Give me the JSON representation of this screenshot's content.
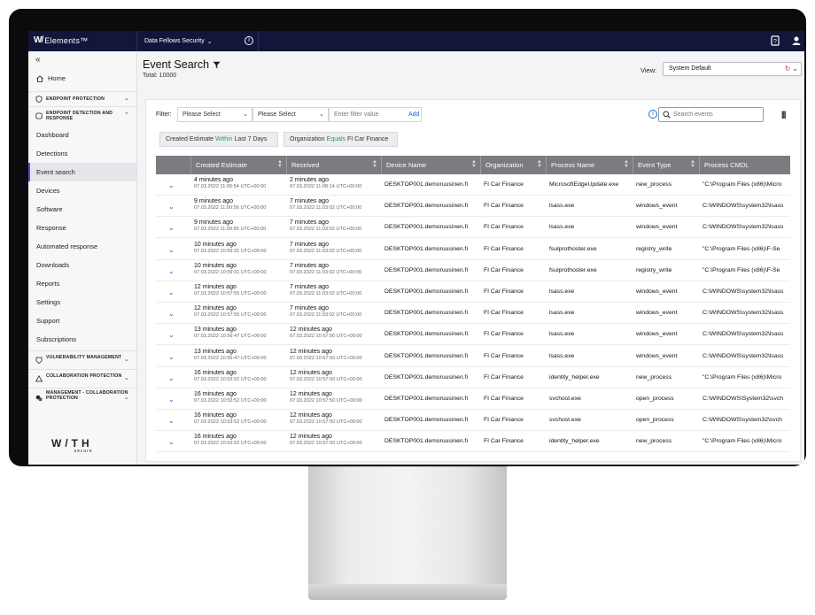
{
  "topbar": {
    "brand": "Elements™",
    "brand_mark": "W/",
    "org": "Data Fellows Security",
    "org_chevron": "⌄"
  },
  "sidebar": {
    "collapse": "«",
    "home": "Home",
    "groups": [
      {
        "label": "ENDPOINT PROTECTION",
        "icon": "shield-icon",
        "chevron": "⌄"
      },
      {
        "label": "ENDPOINT DETECTION AND RESPONSE",
        "icon": "edr-icon",
        "chevron": "⌃"
      }
    ],
    "items": [
      "Dashboard",
      "Detections",
      "Event search",
      "Devices",
      "Software",
      "Response",
      "Automated response",
      "Downloads",
      "Reports",
      "Settings",
      "Support",
      "Subscriptions"
    ],
    "active_item": "Event search",
    "groups_bottom": [
      {
        "label": "VULNERABILITY MANAGEMENT",
        "icon": "vulnerability-icon",
        "chevron": "⌄"
      },
      {
        "label": "COLLABORATION PROTECTION",
        "icon": "collaboration-icon",
        "chevron": "⌄"
      },
      {
        "label": "MANAGEMENT - COLLABORATION PROTECTION",
        "icon": "management-icon",
        "chevron": "⌄"
      }
    ],
    "logo": "W/TH",
    "logo_sub": "secure"
  },
  "page": {
    "title": "Event Search",
    "total": "Total: 10000",
    "view_label": "View:",
    "view_value": "System Default"
  },
  "filters": {
    "label": "Filter:",
    "select1": "Please Select",
    "select2": "Please Select",
    "value_placeholder": "Enter filter value",
    "add": "Add",
    "search_placeholder": "Search events",
    "chips": [
      {
        "field": "Created Estimate",
        "op": "Within",
        "value": "Last 7 Days"
      },
      {
        "field": "Organization",
        "op": "Equals",
        "value": "FI Car Finance"
      }
    ]
  },
  "table": {
    "columns": [
      "Created Estimate",
      "Received",
      "Device Name",
      "Organization",
      "Process Name",
      "Event Type",
      "Process CMDL"
    ],
    "rows": [
      {
        "created": "4 minutes ago",
        "created_ts": "07.03.2022 11:05:54 UTC+00:00",
        "received": "2 minutes ago",
        "received_ts": "07.03.2022 11:08:14 UTC+00:00",
        "device": "DESKTOP001.demoruusinen.fi",
        "org": "FI Car Finance",
        "process": "MicrosoftEdgeUpdate.exe",
        "event": "new_process",
        "cmdl": "\"C:\\Program Files (x86)\\Micro"
      },
      {
        "created": "9 minutes ago",
        "created_ts": "07.03.2022 11:00:56 UTC+00:00",
        "received": "7 minutes ago",
        "received_ts": "07.03.2022 11:03:02 UTC+00:00",
        "device": "DESKTOP001.demoruusinen.fi",
        "org": "FI Car Finance",
        "process": "lsass.exe",
        "event": "windows_event",
        "cmdl": "C:\\WINDOWS\\system32\\lsass"
      },
      {
        "created": "9 minutes ago",
        "created_ts": "07.03.2022 11:00:56 UTC+00:00",
        "received": "7 minutes ago",
        "received_ts": "07.03.2022 11:03:02 UTC+00:00",
        "device": "DESKTOP001.demoruusinen.fi",
        "org": "FI Car Finance",
        "process": "lsass.exe",
        "event": "windows_event",
        "cmdl": "C:\\WINDOWS\\system32\\lsass"
      },
      {
        "created": "10 minutes ago",
        "created_ts": "07.03.2022 10:59:31 UTC+00:00",
        "received": "7 minutes ago",
        "received_ts": "07.03.2022 11:03:02 UTC+00:00",
        "device": "DESKTOP001.demoruusinen.fi",
        "org": "FI Car Finance",
        "process": "fsulprothoster.exe",
        "event": "registry_write",
        "cmdl": "\"C:\\Program Files (x86)\\F-Se"
      },
      {
        "created": "10 minutes ago",
        "created_ts": "07.03.2022 10:59:31 UTC+00:00",
        "received": "7 minutes ago",
        "received_ts": "07.03.2022 11:03:02 UTC+00:00",
        "device": "DESKTOP001.demoruusinen.fi",
        "org": "FI Car Finance",
        "process": "fsulprothoster.exe",
        "event": "registry_write",
        "cmdl": "\"C:\\Program Files (x86)\\F-Se"
      },
      {
        "created": "12 minutes ago",
        "created_ts": "07.03.2022 10:57:55 UTC+00:00",
        "received": "7 minutes ago",
        "received_ts": "07.03.2022 11:03:02 UTC+00:00",
        "device": "DESKTOP001.demoruusinen.fi",
        "org": "FI Car Finance",
        "process": "lsass.exe",
        "event": "windows_event",
        "cmdl": "C:\\WINDOWS\\system32\\lsass"
      },
      {
        "created": "12 minutes ago",
        "created_ts": "07.03.2022 10:57:55 UTC+00:00",
        "received": "7 minutes ago",
        "received_ts": "07.03.2022 11:03:02 UTC+00:00",
        "device": "DESKTOP001.demoruusinen.fi",
        "org": "FI Car Finance",
        "process": "lsass.exe",
        "event": "windows_event",
        "cmdl": "C:\\WINDOWS\\system32\\lsass"
      },
      {
        "created": "13 minutes ago",
        "created_ts": "07.03.2022 10:56:47 UTC+00:00",
        "received": "12 minutes ago",
        "received_ts": "07.03.2022 10:57:50 UTC+00:00",
        "device": "DESKTOP001.demoruusinen.fi",
        "org": "FI Car Finance",
        "process": "lsass.exe",
        "event": "windows_event",
        "cmdl": "C:\\WINDOWS\\system32\\lsass"
      },
      {
        "created": "13 minutes ago",
        "created_ts": "07.03.2022 10:56:47 UTC+00:00",
        "received": "12 minutes ago",
        "received_ts": "07.03.2022 10:57:50 UTC+00:00",
        "device": "DESKTOP001.demoruusinen.fi",
        "org": "FI Car Finance",
        "process": "lsass.exe",
        "event": "windows_event",
        "cmdl": "C:\\WINDOWS\\system32\\lsass"
      },
      {
        "created": "16 minutes ago",
        "created_ts": "07.03.2022 10:53:52 UTC+00:00",
        "received": "12 minutes ago",
        "received_ts": "07.03.2022 10:57:50 UTC+00:00",
        "device": "DESKTOP001.demoruusinen.fi",
        "org": "FI Car Finance",
        "process": "identity_helper.exe",
        "event": "new_process",
        "cmdl": "\"C:\\Program Files (x86)\\Micro"
      },
      {
        "created": "16 minutes ago",
        "created_ts": "07.03.2022 10:53:52 UTC+00:00",
        "received": "12 minutes ago",
        "received_ts": "07.03.2022 10:57:50 UTC+00:00",
        "device": "DESKTOP001.demoruusinen.fi",
        "org": "FI Car Finance",
        "process": "svchost.exe",
        "event": "open_process",
        "cmdl": "C:\\WINDOWS\\System32\\svch"
      },
      {
        "created": "16 minutes ago",
        "created_ts": "07.03.2022 10:53:52 UTC+00:00",
        "received": "12 minutes ago",
        "received_ts": "07.03.2022 10:57:50 UTC+00:00",
        "device": "DESKTOP001.demoruusinen.fi",
        "org": "FI Car Finance",
        "process": "svchost.exe",
        "event": "open_process",
        "cmdl": "C:\\WINDOWS\\system32\\svch"
      },
      {
        "created": "16 minutes ago",
        "created_ts": "07.03.2022 10:53:52 UTC+00:00",
        "received": "12 minutes ago",
        "received_ts": "07.03.2022 10:57:50 UTC+00:00",
        "device": "DESKTOP001.demoruusinen.fi",
        "org": "FI Car Finance",
        "process": "identity_helper.exe",
        "event": "new_process",
        "cmdl": "\"C:\\Program Files (x86)\\Micro"
      }
    ]
  },
  "colors": {
    "topbar": "#13163a",
    "accent": "#5b4ae0",
    "link": "#1e63c6",
    "op_green": "#2d9c52",
    "table_header": "#7b7b82"
  }
}
